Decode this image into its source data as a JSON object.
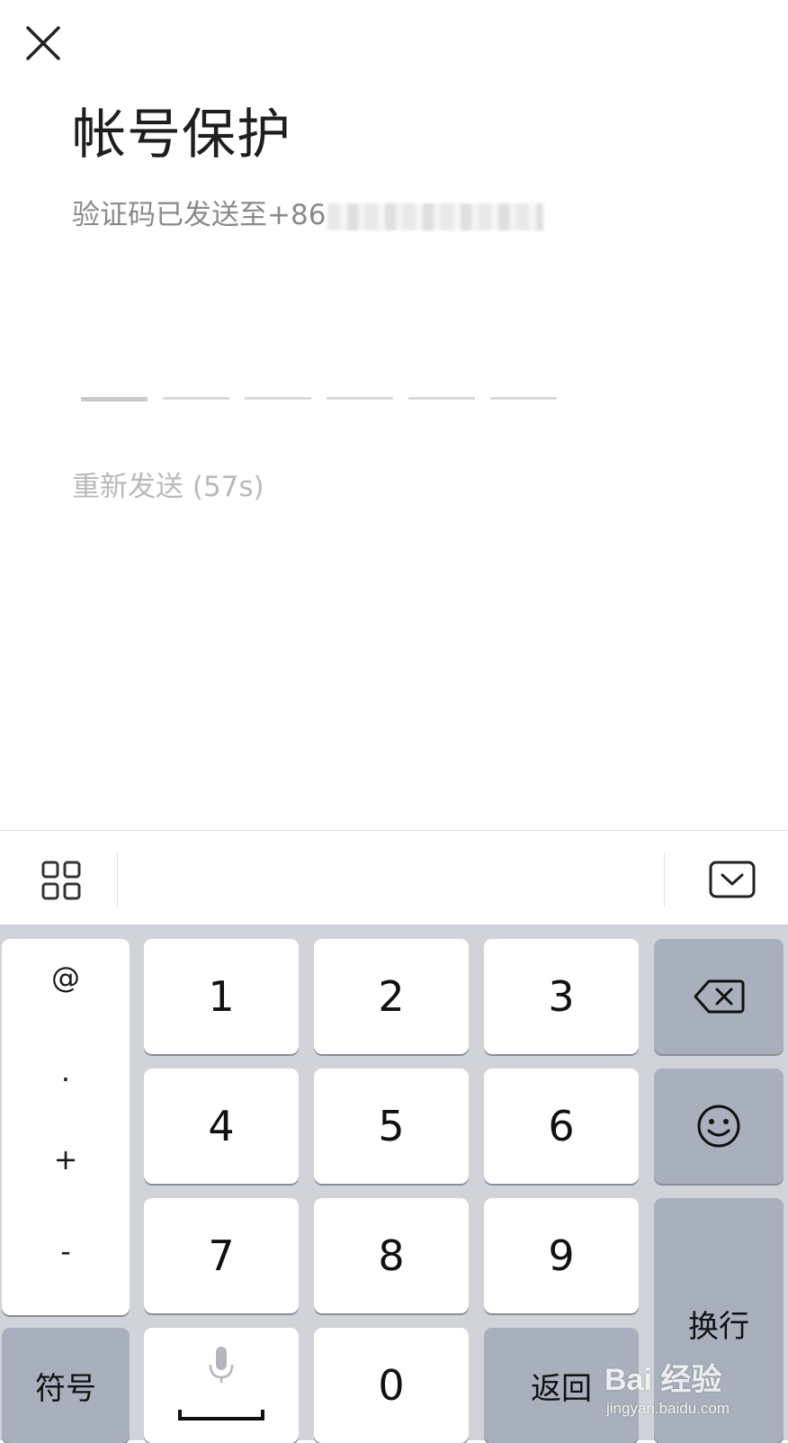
{
  "page": {
    "title": "帐号保护",
    "subtitle_prefix": "验证码已发送至+86",
    "resend": "重新发送 (57s)"
  },
  "code_input": {
    "length": 6,
    "filled": 0
  },
  "keyboard": {
    "symbols": [
      "@",
      ".",
      "+",
      "-"
    ],
    "digits": [
      "1",
      "2",
      "3",
      "4",
      "5",
      "6",
      "7",
      "8",
      "9"
    ],
    "zero": "0",
    "symbol_key": "符号",
    "return_key": "返回",
    "newline_key": "换行"
  },
  "watermark": {
    "brand": "Bai  经验",
    "url": "jingyan.baidu.com"
  },
  "icons": {
    "close": "close-icon",
    "grid": "grid-icon",
    "hide_keyboard": "keyboard-hide-icon",
    "backspace": "backspace-icon",
    "emoji": "emoji-icon",
    "microphone": "microphone-icon"
  },
  "colors": {
    "keyboard_bg": "#d1d3d9",
    "function_key": "#a8b0bd",
    "subtitle": "#8a8a8a",
    "resend": "#b9b9b9"
  }
}
